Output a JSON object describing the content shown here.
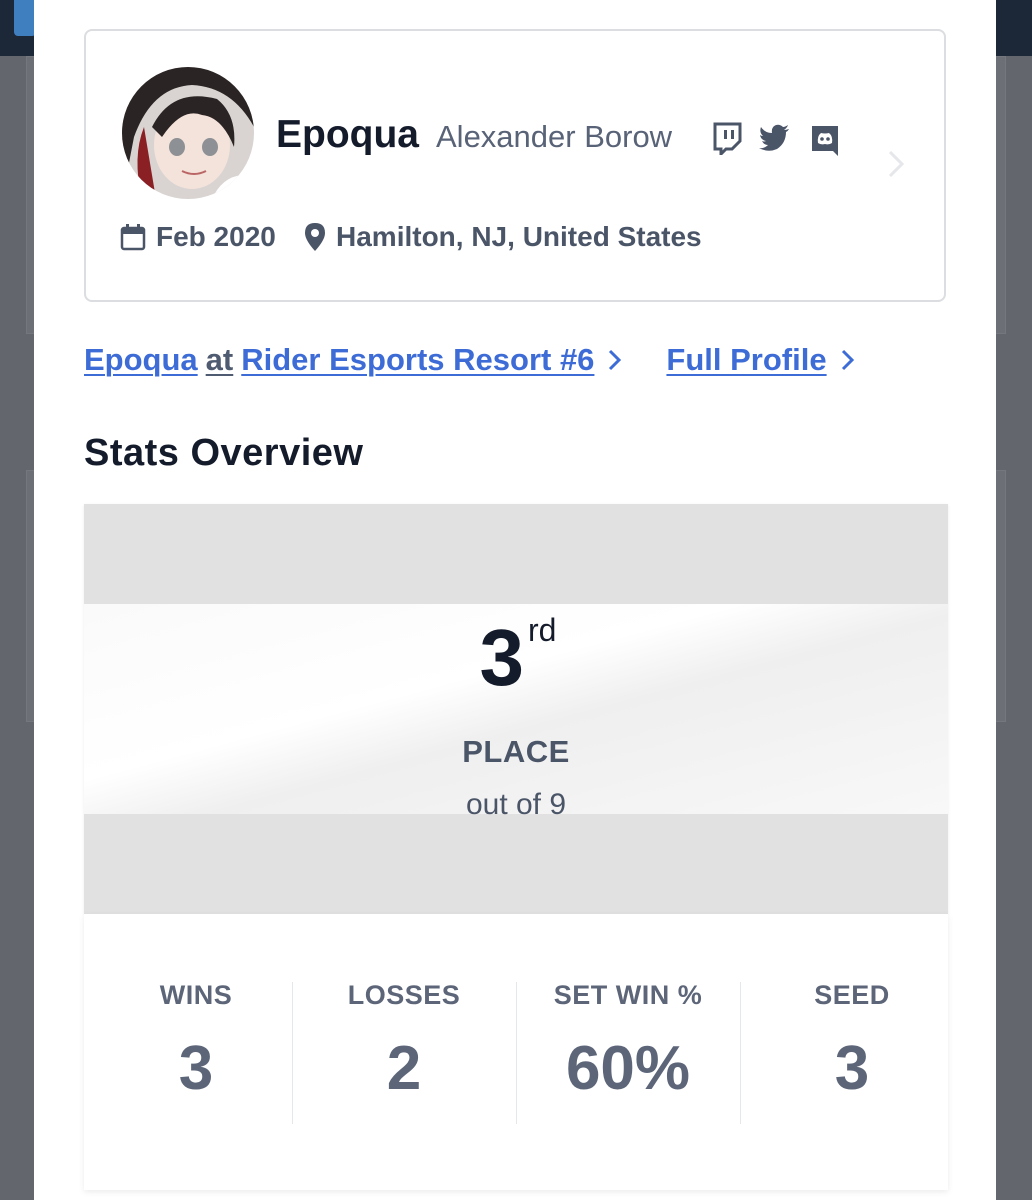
{
  "profile": {
    "gamertag": "Epoqua",
    "real_name": "Alexander Borow",
    "joined": "Feb 2020",
    "location": "Hamilton, NJ, United States",
    "socials": [
      "twitch-icon",
      "twitter-icon",
      "discord-icon"
    ]
  },
  "links": {
    "player": "Epoqua",
    "at": "at",
    "event": "Rider Esports Resort #6",
    "full_profile": "Full Profile"
  },
  "stats": {
    "title": "Stats Overview",
    "placement": {
      "number": "3",
      "suffix": "rd",
      "label": "PLACE",
      "sub": "out of 9"
    },
    "items": [
      {
        "label": "WINS",
        "value": "3"
      },
      {
        "label": "LOSSES",
        "value": "2"
      },
      {
        "label": "SET WIN %",
        "value": "60%"
      },
      {
        "label": "SEED",
        "value": "3"
      }
    ]
  },
  "colors": {
    "link": "#3d6cd6",
    "text_dark": "#141b2b",
    "text_muted": "#5d6679"
  }
}
